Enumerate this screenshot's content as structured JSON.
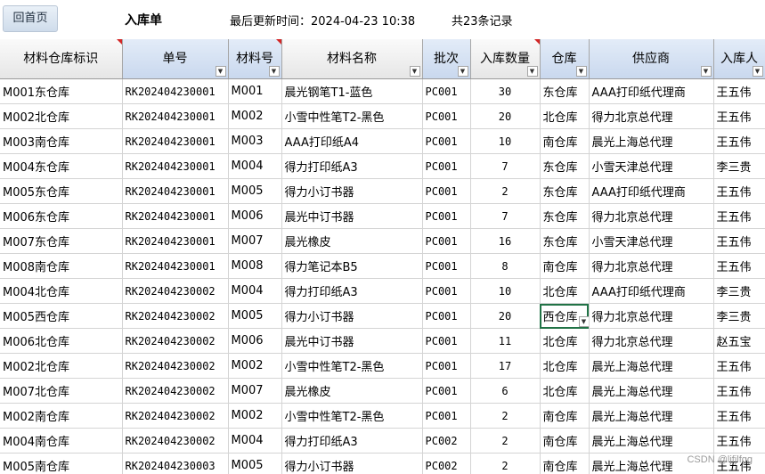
{
  "header": {
    "home_button": "回首页",
    "title": "入库单",
    "update_label": "最后更新时间：2024-04-23 10:38",
    "record_count": "共23条记录"
  },
  "columns": [
    {
      "label": "材料仓库标识",
      "style": "gray",
      "filter": false,
      "red_mark": true
    },
    {
      "label": "单号",
      "style": "blue",
      "filter": true,
      "red_mark": false
    },
    {
      "label": "材料号",
      "style": "blue",
      "filter": true,
      "red_mark": true
    },
    {
      "label": "材料名称",
      "style": "gray",
      "filter": true,
      "red_mark": false
    },
    {
      "label": "批次",
      "style": "blue",
      "filter": true,
      "red_mark": false
    },
    {
      "label": "入库数量",
      "style": "gray",
      "filter": true,
      "red_mark": true
    },
    {
      "label": "仓库",
      "style": "blue",
      "filter": true,
      "red_mark": false
    },
    {
      "label": "供应商",
      "style": "blue",
      "filter": true,
      "red_mark": false
    },
    {
      "label": "入库人",
      "style": "blue",
      "filter": true,
      "red_mark": false
    }
  ],
  "rows": [
    [
      "M001东仓库",
      "RK202404230001",
      "M001",
      "晨光钢笔T1-蓝色",
      "PC001",
      "30",
      "东仓库",
      "AAA打印纸代理商",
      "王五伟"
    ],
    [
      "M002北仓库",
      "RK202404230001",
      "M002",
      "小雪中性笔T2-黑色",
      "PC001",
      "20",
      "北仓库",
      "得力北京总代理",
      "王五伟"
    ],
    [
      "M003南仓库",
      "RK202404230001",
      "M003",
      "AAA打印纸A4",
      "PC001",
      "10",
      "南仓库",
      "晨光上海总代理",
      "王五伟"
    ],
    [
      "M004东仓库",
      "RK202404230001",
      "M004",
      "得力打印纸A3",
      "PC001",
      "7",
      "东仓库",
      "小雪天津总代理",
      "李三贵"
    ],
    [
      "M005东仓库",
      "RK202404230001",
      "M005",
      "得力小订书器",
      "PC001",
      "2",
      "东仓库",
      "AAA打印纸代理商",
      "王五伟"
    ],
    [
      "M006东仓库",
      "RK202404230001",
      "M006",
      "晨光中订书器",
      "PC001",
      "7",
      "东仓库",
      "得力北京总代理",
      "王五伟"
    ],
    [
      "M007东仓库",
      "RK202404230001",
      "M007",
      "晨光橡皮",
      "PC001",
      "16",
      "东仓库",
      "小雪天津总代理",
      "王五伟"
    ],
    [
      "M008南仓库",
      "RK202404230001",
      "M008",
      "得力笔记本B5",
      "PC001",
      "8",
      "南仓库",
      "得力北京总代理",
      "王五伟"
    ],
    [
      "M004北仓库",
      "RK202404230002",
      "M004",
      "得力打印纸A3",
      "PC001",
      "10",
      "北仓库",
      "AAA打印纸代理商",
      "李三贵"
    ],
    [
      "M005西仓库",
      "RK202404230002",
      "M005",
      "得力小订书器",
      "PC001",
      "20",
      "西仓库",
      "得力北京总代理",
      "李三贵"
    ],
    [
      "M006北仓库",
      "RK202404230002",
      "M006",
      "晨光中订书器",
      "PC001",
      "11",
      "北仓库",
      "得力北京总代理",
      "赵五宝"
    ],
    [
      "M002北仓库",
      "RK202404230002",
      "M002",
      "小雪中性笔T2-黑色",
      "PC001",
      "17",
      "北仓库",
      "晨光上海总代理",
      "王五伟"
    ],
    [
      "M007北仓库",
      "RK202404230002",
      "M007",
      "晨光橡皮",
      "PC001",
      "6",
      "北仓库",
      "晨光上海总代理",
      "王五伟"
    ],
    [
      "M002南仓库",
      "RK202404230002",
      "M002",
      "小雪中性笔T2-黑色",
      "PC001",
      "2",
      "南仓库",
      "晨光上海总代理",
      "王五伟"
    ],
    [
      "M004南仓库",
      "RK202404230002",
      "M004",
      "得力打印纸A3",
      "PC002",
      "2",
      "南仓库",
      "晨光上海总代理",
      "王五伟"
    ],
    [
      "M005南仓库",
      "RK202404230003",
      "M005",
      "得力小订书器",
      "PC002",
      "2",
      "南仓库",
      "晨光上海总代理",
      "王五伟"
    ]
  ],
  "selected_cell": {
    "row": 9,
    "col": 6
  },
  "watermark": "CSDN @ljfjlfgg"
}
